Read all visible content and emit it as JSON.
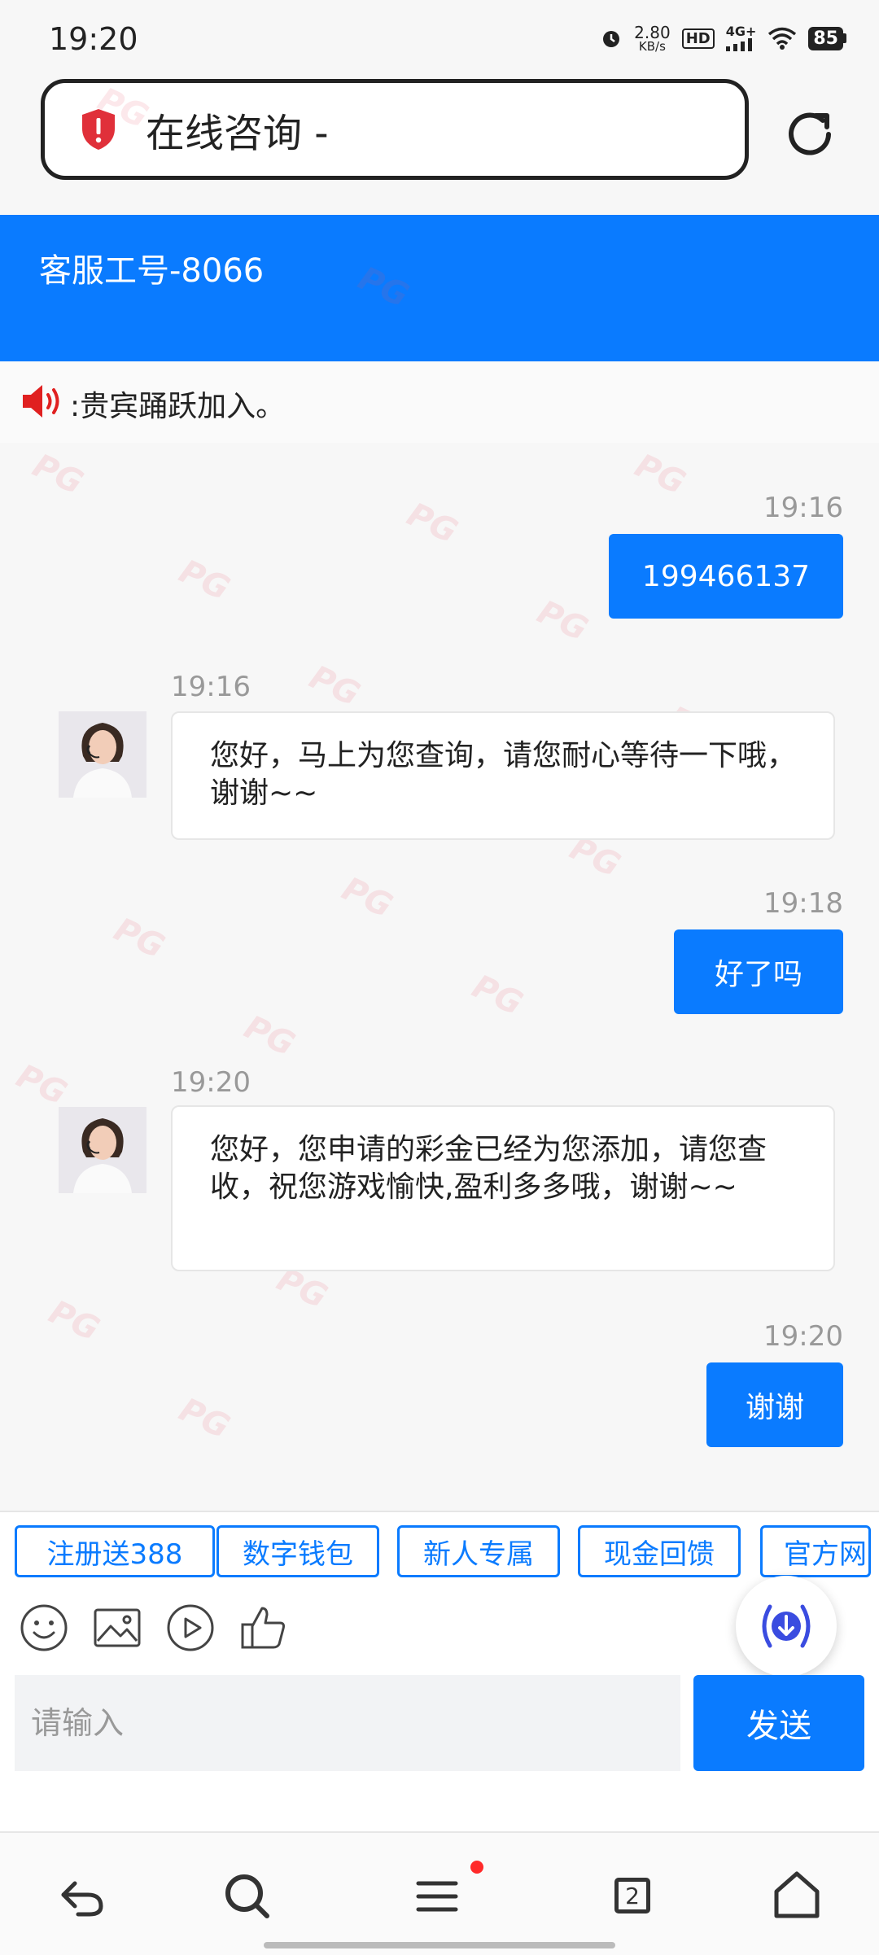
{
  "status_bar": {
    "time": "19:20",
    "net_speed_value": "2.80",
    "net_speed_unit": "KB/s",
    "hd_label": "HD",
    "network_label": "4G+",
    "battery": "85"
  },
  "browser": {
    "url_title": "在线咨询 -"
  },
  "chat": {
    "agent_id": "客服工号-8066",
    "notice": ":贵宾踊跃加入。",
    "messages": [
      {
        "dir": "out",
        "time": "19:16",
        "text": "199466137"
      },
      {
        "dir": "in",
        "time": "19:16",
        "text": "您好，马上为您查询，请您耐心等待一下哦，谢谢~~"
      },
      {
        "dir": "out",
        "time": "19:18",
        "text": "好了吗"
      },
      {
        "dir": "in",
        "time": "19:20",
        "text": "您好，您申请的彩金已经为您添加，请您查收，祝您游戏愉快,盈利多多哦，谢谢~~"
      },
      {
        "dir": "out",
        "time": "19:20",
        "text": "谢谢"
      }
    ]
  },
  "quick_tags": [
    "注册送388",
    "数字钱包",
    "新人专属",
    "现金回馈",
    "官方网"
  ],
  "toolbar": {
    "icons": [
      "emoji-icon",
      "image-icon",
      "video-icon",
      "thumbs-up-icon"
    ]
  },
  "input": {
    "placeholder": "请输入",
    "value": "",
    "send_label": "发送"
  },
  "bottom_nav": {
    "tab_count": "2"
  },
  "colors": {
    "accent": "#0a7bff",
    "shield": "#e0303a",
    "notification_dot": "#ff2a2a"
  }
}
